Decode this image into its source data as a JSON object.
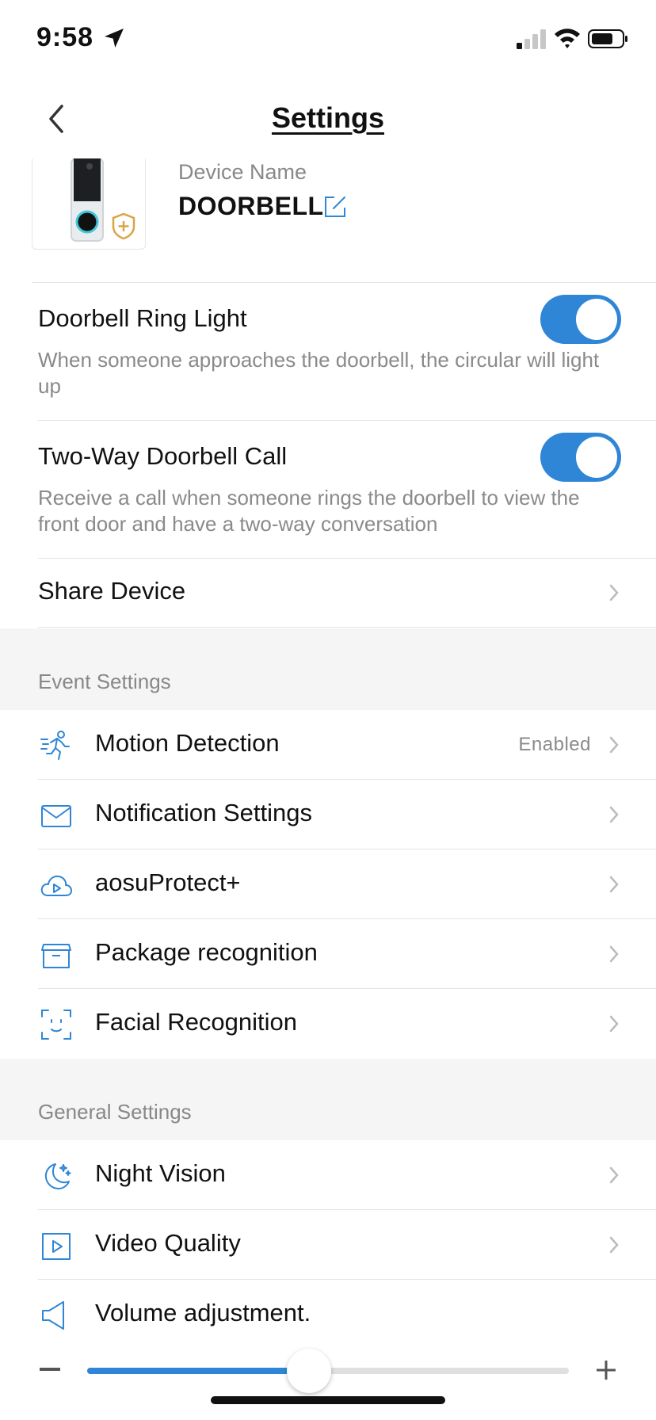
{
  "status_bar": {
    "time": "9:58"
  },
  "header": {
    "title": "Settings"
  },
  "device": {
    "name_label": "Device Name",
    "name_value": "DOORBELL"
  },
  "ring_light": {
    "title": "Doorbell Ring Light",
    "description": "When someone approaches the doorbell, the circular will light up",
    "enabled": true
  },
  "two_way_call": {
    "title": "Two-Way Doorbell Call",
    "description": "Receive a call when someone rings the doorbell to view the front door and have a two-way conversation",
    "enabled": true
  },
  "share_device": {
    "label": "Share Device"
  },
  "event_settings": {
    "header": "Event Settings",
    "items": [
      {
        "label": "Motion Detection",
        "status": "Enabled",
        "icon": "running-person-icon"
      },
      {
        "label": "Notification Settings",
        "status": "",
        "icon": "envelope-icon"
      },
      {
        "label": "aosuProtect+",
        "status": "",
        "icon": "cloud-play-icon"
      },
      {
        "label": "Package recognition",
        "status": "",
        "icon": "package-box-icon"
      },
      {
        "label": "Facial Recognition",
        "status": "",
        "icon": "face-scan-icon"
      }
    ]
  },
  "general_settings": {
    "header": "General Settings",
    "items": [
      {
        "label": "Night Vision",
        "icon": "moon-stars-icon"
      },
      {
        "label": "Video Quality",
        "icon": "play-square-icon"
      },
      {
        "label": "Volume adjustment.",
        "icon": "speaker-icon"
      }
    ]
  },
  "volume": {
    "level_fraction": 0.46
  },
  "colors": {
    "accent": "#2f86d6",
    "badge": "#d9a545"
  }
}
